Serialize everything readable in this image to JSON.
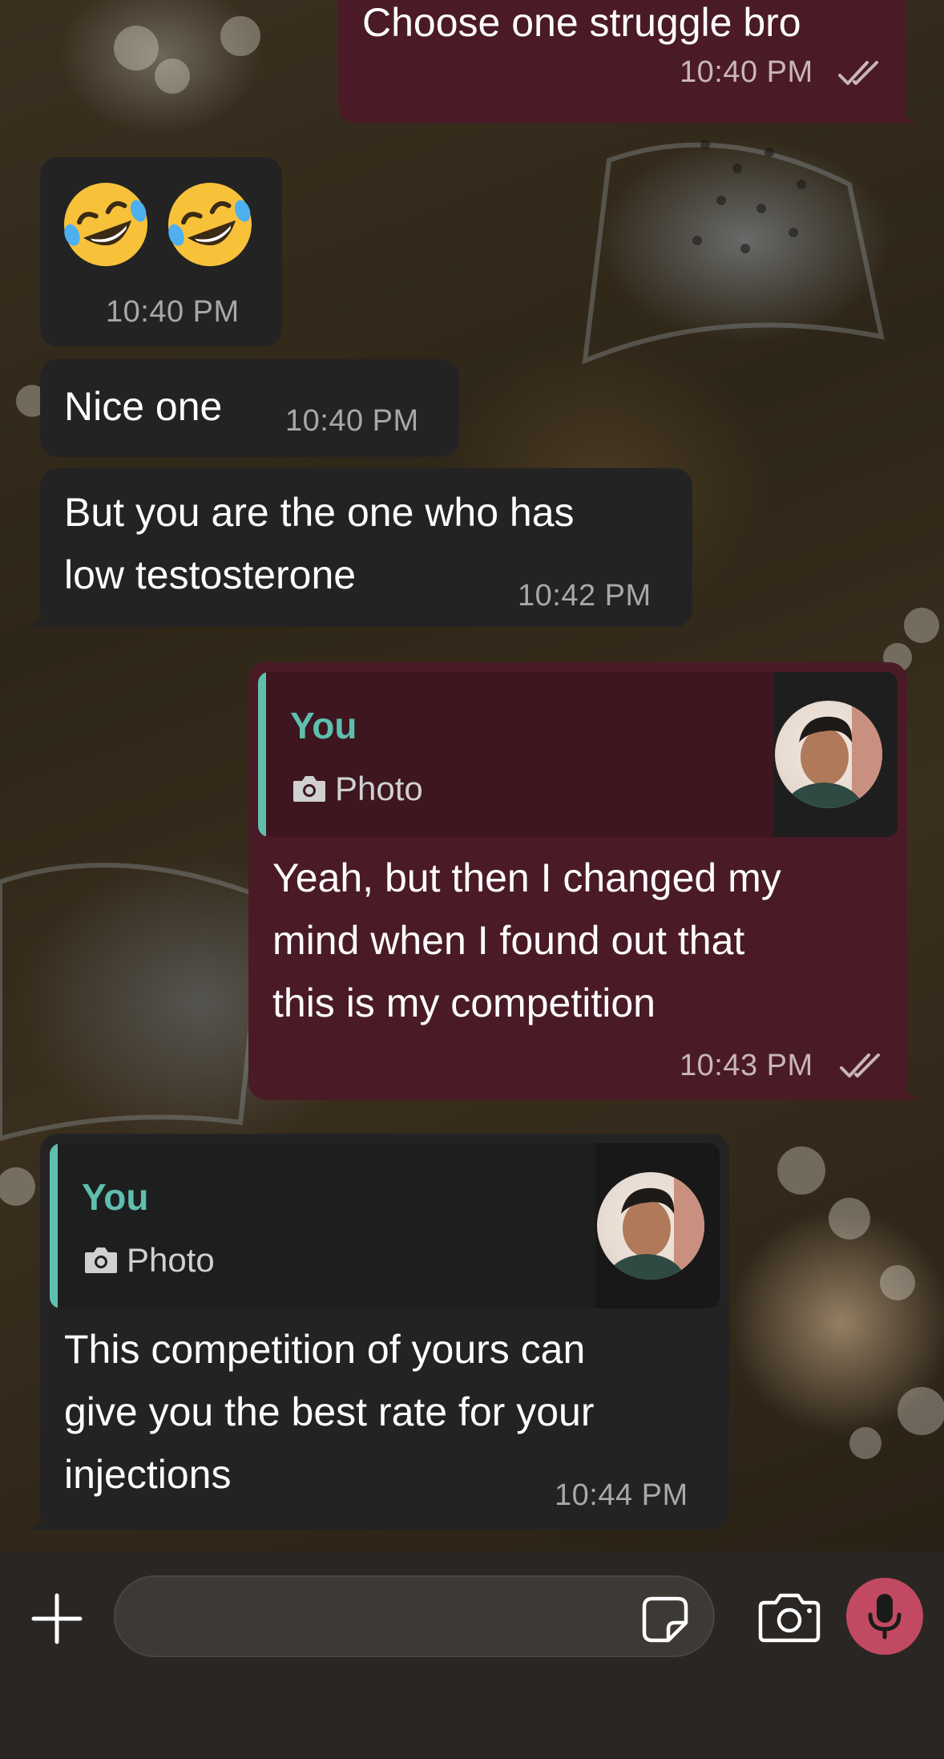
{
  "messages": [
    {
      "id": "m1",
      "direction": "outgoing",
      "text": "Choose one struggle bro",
      "time": "10:40 PM",
      "status": "read"
    },
    {
      "id": "m2",
      "direction": "incoming",
      "text": "🤣🤣",
      "time": "10:40 PM"
    },
    {
      "id": "m3",
      "direction": "incoming",
      "text": "Nice one",
      "time": "10:40 PM"
    },
    {
      "id": "m4",
      "direction": "incoming",
      "text_lines": [
        "But you are the one who has",
        "low testosterone"
      ],
      "time": "10:42 PM"
    },
    {
      "id": "m5",
      "direction": "outgoing",
      "reply": {
        "author": "You",
        "type": "Photo"
      },
      "text_lines": [
        "Yeah, but then I changed my",
        "mind when I found out that",
        "this is my competition"
      ],
      "time": "10:43 PM",
      "status": "read"
    },
    {
      "id": "m6",
      "direction": "incoming",
      "reply": {
        "author": "You",
        "type": "Photo"
      },
      "text_lines": [
        "This competition of yours can",
        "give you the best rate for your",
        "injections"
      ],
      "time": "10:44 PM"
    }
  ],
  "input_bar": {
    "placeholder": "",
    "icons": [
      "plus-icon",
      "sticker-icon",
      "camera-icon",
      "microphone-icon"
    ]
  },
  "colors": {
    "outgoing_bubble": "#4a1b27",
    "incoming_bubble": "#232323",
    "reply_accent": "#5fbfae",
    "mic_button": "#c14a62"
  }
}
